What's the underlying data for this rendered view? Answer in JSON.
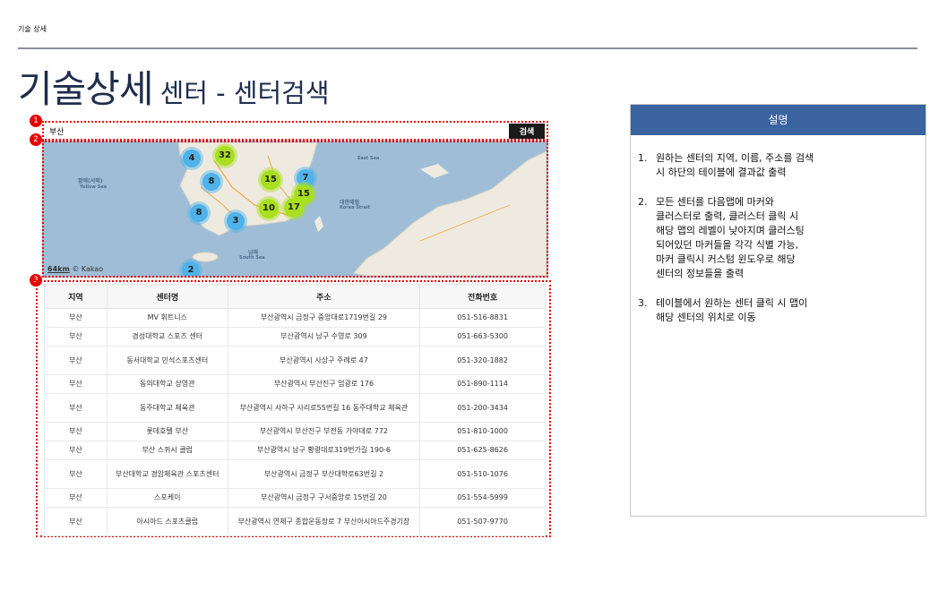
{
  "breadcrumb": "기술 상세",
  "title": {
    "main": "기술상세",
    "sub": "센터 - 센터검색"
  },
  "markers": [
    "1",
    "2",
    "3"
  ],
  "search": {
    "value": "부산",
    "button_label": "검색"
  },
  "map": {
    "clusters": [
      {
        "count": "32",
        "color": "green"
      },
      {
        "count": "4",
        "color": "blue"
      },
      {
        "count": "8",
        "color": "blue"
      },
      {
        "count": "15",
        "color": "green"
      },
      {
        "count": "7",
        "color": "blue"
      },
      {
        "count": "15",
        "color": "green"
      },
      {
        "count": "10",
        "color": "green"
      },
      {
        "count": "17",
        "color": "green"
      },
      {
        "count": "8",
        "color": "blue"
      },
      {
        "count": "3",
        "color": "blue"
      },
      {
        "count": "2",
        "color": "blue"
      }
    ],
    "labels": [
      "황해(서해)",
      "Yellow Sea",
      "대한해협",
      "Korea Strait",
      "남해",
      "South Sea",
      "East Sea"
    ],
    "scale": "64km",
    "attribution": "© Kakao",
    "colors": {
      "sea": "#9fbdd6",
      "land": "#f2efe9",
      "blue_cluster": "#4fb3ea",
      "green_cluster": "#a8e01f"
    }
  },
  "table": {
    "headers": [
      "지역",
      "센터명",
      "주소",
      "전화번호"
    ],
    "rows": [
      [
        "부산",
        "MV 휘트니스",
        "부산광역시 금정구 중앙대로1719번길 29",
        "051-516-8831"
      ],
      [
        "부산",
        "경성대학교 스포츠 센터",
        "부산광역시 남구 수영로 309",
        "051-663-5300"
      ],
      [
        "부산",
        "동서대학교 민석스포츠센터",
        "부산광역시 사상구 주례로 47",
        "051-320-1882"
      ],
      [
        "부산",
        "동의대학교 상영관",
        "부산광역시 부산진구 엄광로 176",
        "051-890-1114"
      ],
      [
        "부산",
        "동주대학교 체육관",
        "부산광역시 사하구 사리로55번길 16 동주대학교 체육관",
        "051-200-3434"
      ],
      [
        "부산",
        "롯데호텔 부산",
        "부산광역시 부산진구 부전동 가야대로 772",
        "051-810-1000"
      ],
      [
        "부산",
        "부산 스퀴시 클럽",
        "부산광역시 남구 황령대로319번가길 190-6",
        "051-625-8626"
      ],
      [
        "부산",
        "부산대학교 경암체육관 스포츠센터",
        "부산광역시 금정구 부산대학로63번길 2",
        "051-510-1076"
      ],
      [
        "부산",
        "스포케이",
        "부산광역시 금정구 구서중앙로 15번길 20",
        "051-554-5999"
      ],
      [
        "부산",
        "아시아드 스포츠클럽",
        "부산광역시 연제구 종합운동장로 7 부산아시아드주경기장",
        "051-507-9770"
      ]
    ]
  },
  "description": {
    "header": "설명",
    "items": [
      {
        "num": "1.",
        "text": "원하는 센터의 지역, 이름, 주소를 검색\n시 하단의 테이블에 결과값 출력"
      },
      {
        "num": "2.",
        "text": "모든 센터를 다음맵에 마커와\n클러스터로 출력, 클러스터 클릭 시\n해당 맵의 레벨이 낮아지며 클러스팅\n되어있던 마커들을 각각 식별 가능,\n마커 클릭시 커스텀 윈도우로 해당\n센터의 정보들을 출력"
      },
      {
        "num": "3.",
        "text": "테이블에서 원하는 센터 클릭 시 맵이\n해당 센터의 위치로 이동"
      }
    ]
  }
}
